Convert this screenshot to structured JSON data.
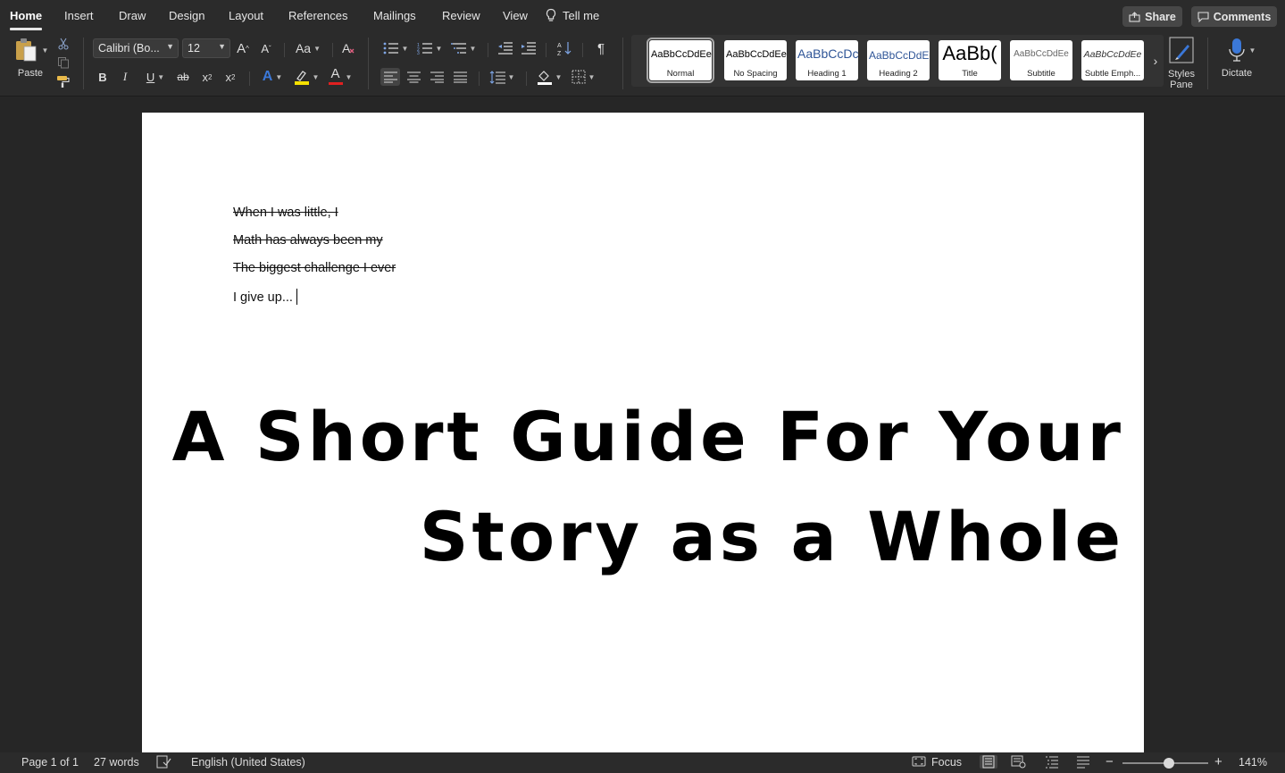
{
  "tabs": [
    {
      "label": "Home",
      "active": true
    },
    {
      "label": "Insert"
    },
    {
      "label": "Draw"
    },
    {
      "label": "Design"
    },
    {
      "label": "Layout"
    },
    {
      "label": "References"
    },
    {
      "label": "Mailings"
    },
    {
      "label": "Review"
    },
    {
      "label": "View"
    }
  ],
  "tell_me": "Tell me",
  "share_label": "Share",
  "comments_label": "Comments",
  "ribbon": {
    "paste_label": "Paste",
    "font_name": "Calibri (Bo...",
    "font_size": "12",
    "grow_font": "A",
    "shrink_font": "A",
    "change_case": "Aa",
    "bold": "B",
    "italic": "I",
    "underline": "U",
    "strikethrough": "ab",
    "subscript": "x",
    "superscript": "x",
    "text_effects": "A",
    "font_color_letter": "A",
    "pilcrow": "¶",
    "styles_pane_label": "Styles Pane",
    "dictate_label": "Dictate",
    "styles": [
      {
        "preview": "AaBbCcDdEe",
        "name": "Normal"
      },
      {
        "preview": "AaBbCcDdEe",
        "name": "No Spacing"
      },
      {
        "preview": "AaBbCcDc",
        "name": "Heading 1"
      },
      {
        "preview": "AaBbCcDdEe",
        "name": "Heading 2"
      },
      {
        "preview": "AaBb(",
        "name": "Title"
      },
      {
        "preview": "AaBbCcDdEe",
        "name": "Subtitle"
      },
      {
        "preview": "AaBbCcDdEe",
        "name": "Subtle Emph..."
      }
    ]
  },
  "document": {
    "lines": [
      {
        "text": "When I was little, I",
        "strikethrough": true
      },
      {
        "text": "Math has always been my",
        "strikethrough": true
      },
      {
        "text": "The biggest challenge I ever",
        "strikethrough": true
      },
      {
        "text": "I give up...",
        "strikethrough": false
      }
    ],
    "title_line1": "A Short Guide For Your",
    "title_line2": "Story as a Whole"
  },
  "status": {
    "page": "Page 1 of 1",
    "words": "27 words",
    "language": "English (United States)",
    "focus": "Focus",
    "zoom": "141%",
    "zoom_minus": "−",
    "zoom_plus": "+"
  },
  "colors": {
    "highlight": "#f5e000",
    "font_color": "#e02020",
    "text_effects": "#3b78d8"
  }
}
